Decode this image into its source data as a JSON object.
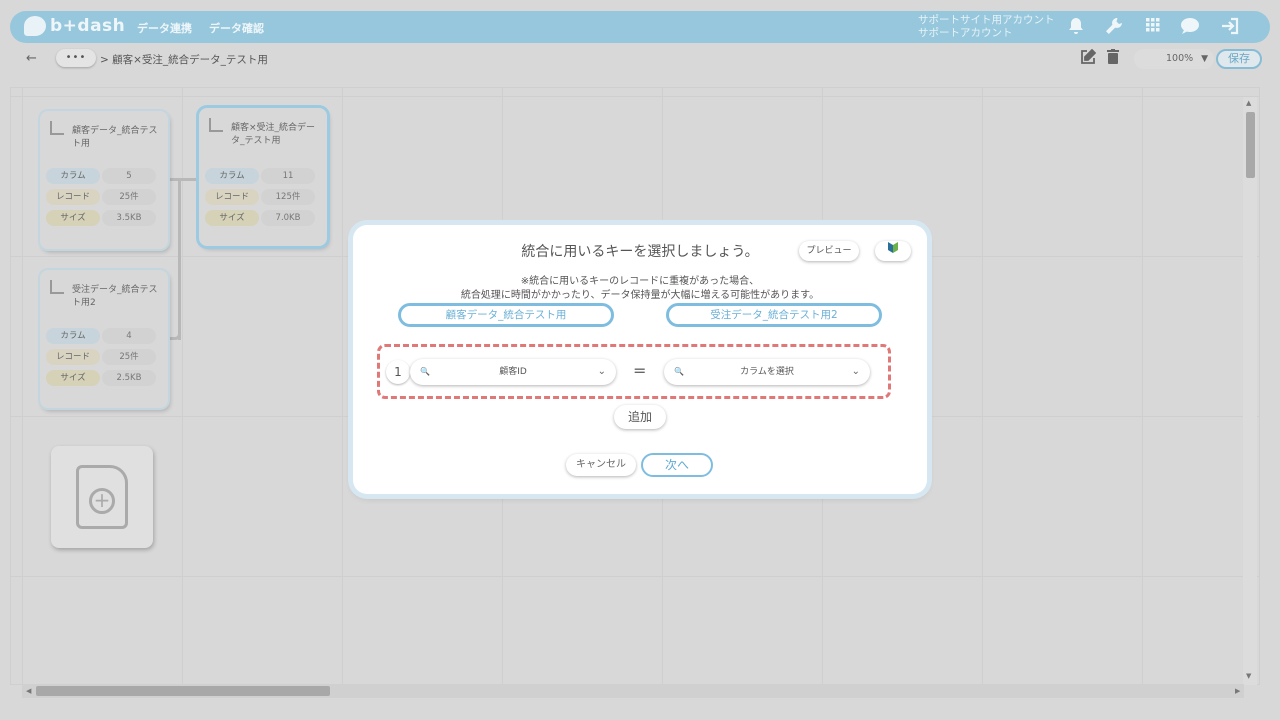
{
  "header": {
    "logo_text": "b+dash",
    "nav": [
      "データ連携",
      "データ確認"
    ],
    "account_line1": "サポートサイト用アカウント",
    "account_line2": "サポートアカウント",
    "icons": [
      "bell-icon",
      "wrench-icon",
      "grid-icon",
      "chat-icon",
      "logout-icon"
    ]
  },
  "toolbar": {
    "back": "←",
    "more": "•••",
    "breadcrumb": "> 顧客×受注_統合データ_テスト用",
    "zoom": "100%",
    "save_label": "保存"
  },
  "cards": [
    {
      "title": "顧客データ_統合テスト用",
      "stats": [
        {
          "label": "カラム",
          "value": "5"
        },
        {
          "label": "レコード",
          "value": "25件"
        },
        {
          "label": "サイズ",
          "value": "3.5KB"
        }
      ]
    },
    {
      "title": "受注データ_統合テスト用2",
      "stats": [
        {
          "label": "カラム",
          "value": "4"
        },
        {
          "label": "レコード",
          "value": "25件"
        },
        {
          "label": "サイズ",
          "value": "2.5KB"
        }
      ]
    },
    {
      "title": "顧客×受注_統合データ_テスト用",
      "stats": [
        {
          "label": "カラム",
          "value": "11"
        },
        {
          "label": "レコード",
          "value": "125件"
        },
        {
          "label": "サイズ",
          "value": "7.0KB"
        }
      ]
    }
  ],
  "modal": {
    "title": "統合に用いるキーを選択しましょう。",
    "preview_label": "プレビュー",
    "notice_line1": "※統合に用いるキーのレコードに重複があった場合、",
    "notice_line2": "統合処理に時間がかかったり、データ保持量が大幅に増える可能性があります。",
    "left_table": "顧客データ_統合テスト用",
    "right_table": "受注データ_統合テスト用2",
    "row_number": "1",
    "left_key": "顧客ID",
    "equals": "=",
    "right_key": "カラムを選択",
    "add_label": "追加",
    "cancel_label": "キャンセル",
    "next_label": "次へ"
  }
}
